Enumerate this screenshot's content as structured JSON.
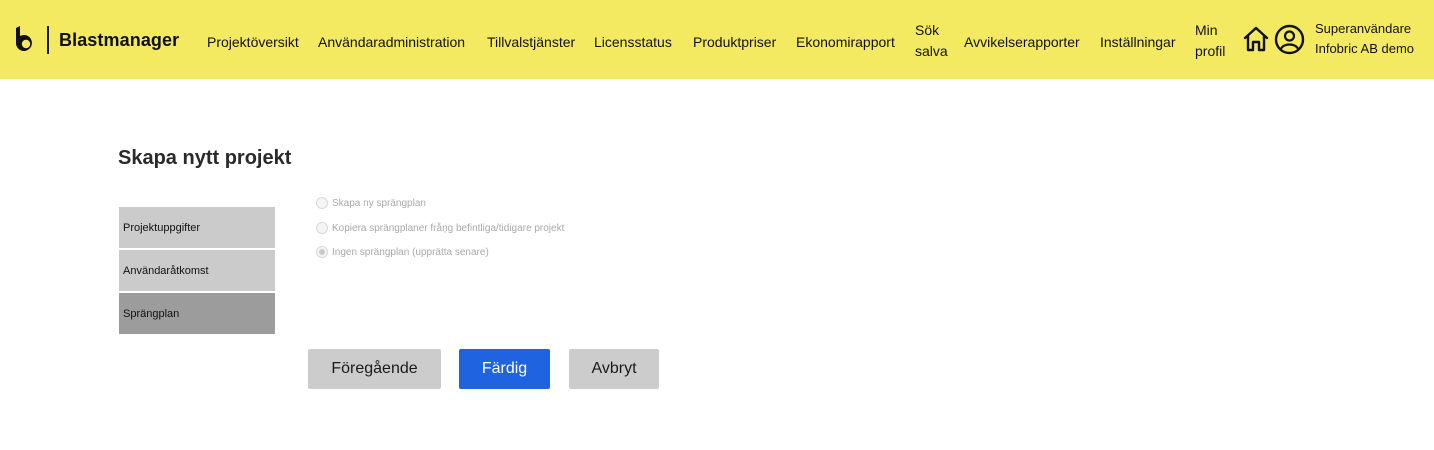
{
  "header": {
    "brand": "Blastmanager",
    "nav": [
      {
        "lines": [
          "Projektöversikt"
        ]
      },
      {
        "lines": [
          "Användaradministration"
        ]
      },
      {
        "lines": [
          "Tillvalstjänster"
        ]
      },
      {
        "lines": [
          "Licensstatus"
        ]
      },
      {
        "lines": [
          "Produktpriser"
        ]
      },
      {
        "lines": [
          "Ekonomirapport"
        ]
      },
      {
        "lines": [
          "Sök",
          "salva"
        ]
      },
      {
        "lines": [
          "Avvikelserapporter"
        ]
      },
      {
        "lines": [
          "Inställningar"
        ]
      },
      {
        "lines": [
          "Min",
          "profil"
        ]
      }
    ],
    "user": {
      "role": "Superanvändare",
      "company": "Infobric AB demo"
    }
  },
  "page": {
    "title": "Skapa nytt projekt",
    "steps": [
      {
        "label": "Projektuppgifter",
        "active": false
      },
      {
        "label": "Användaråtkomst",
        "active": false
      },
      {
        "label": "Sprängplan",
        "active": true
      }
    ],
    "options": [
      {
        "label": "Skapa ny sprängplan",
        "checked": false
      },
      {
        "label": "Kopiera sprängplaner fråņg befintliga/tidigare projekt",
        "checked": false
      },
      {
        "label": "Ingen sprängplan (upprätta senare)",
        "checked": true
      }
    ],
    "buttons": {
      "previous": "Föregående",
      "done": "Färdig",
      "cancel": "Avbryt"
    }
  },
  "colors": {
    "header_bg": "#f3ea61",
    "primary_button": "#1f63e0",
    "secondary_button": "#cccccc",
    "active_step": "#9c9c9c",
    "step": "#cbcbcb"
  }
}
